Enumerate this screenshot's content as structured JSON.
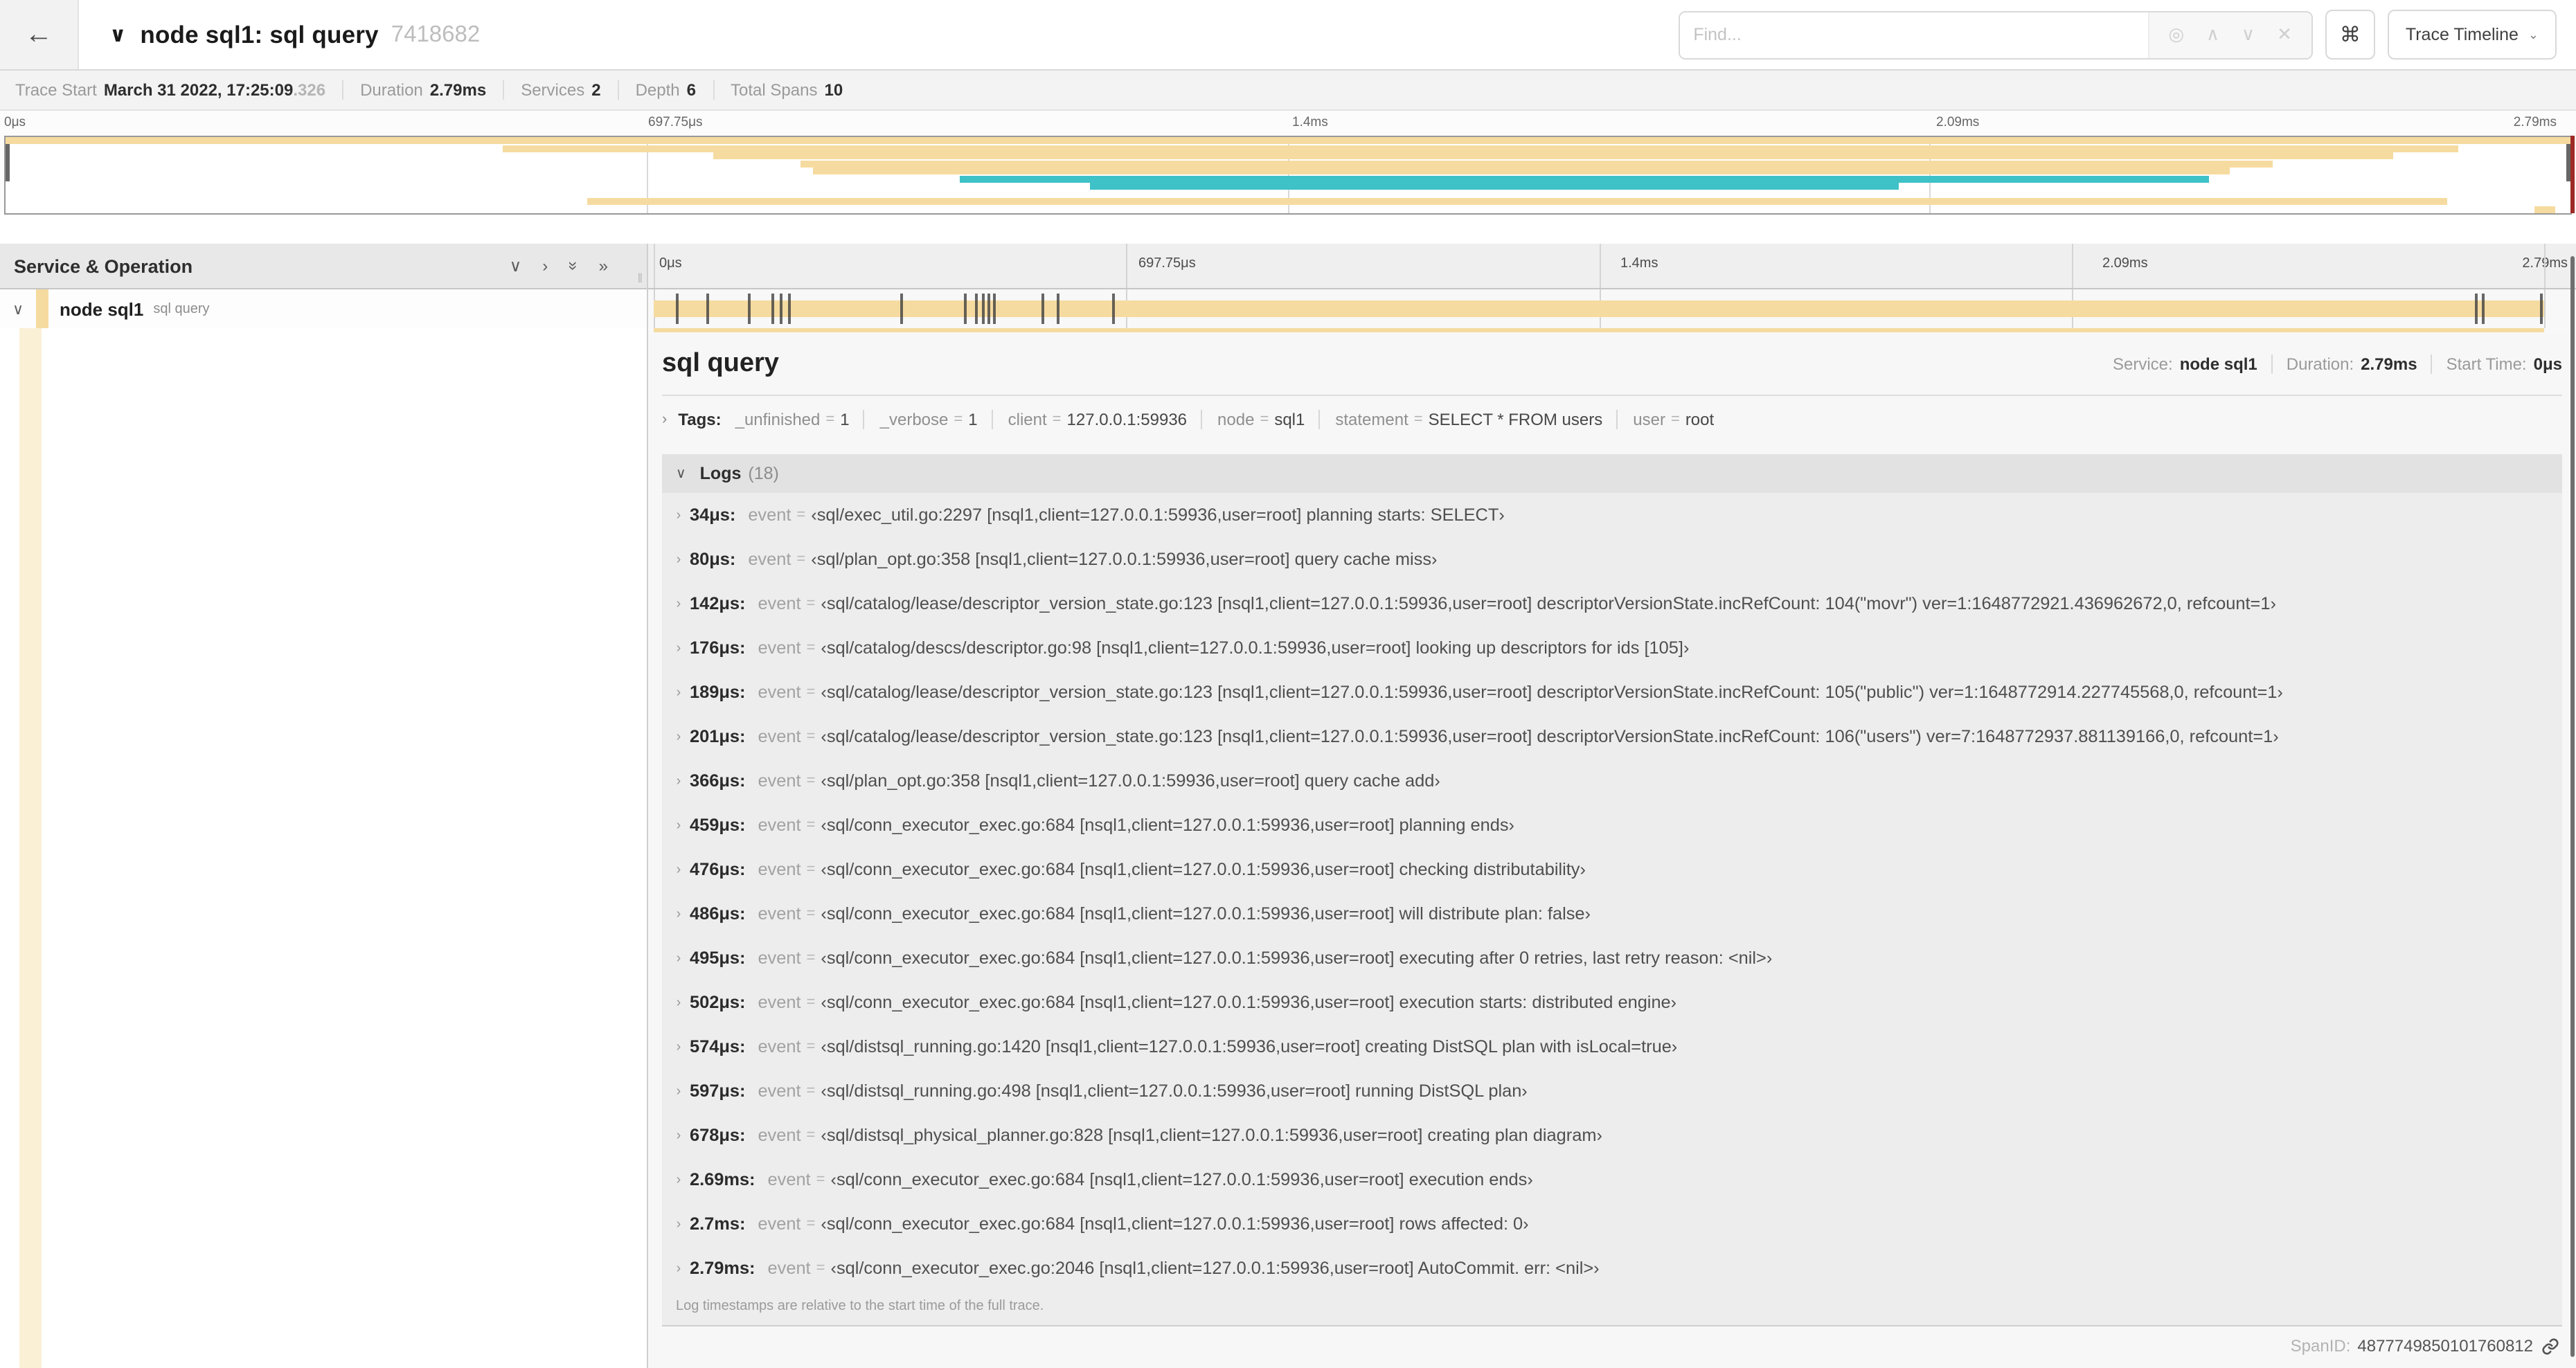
{
  "duration_us": 2790,
  "colors": {
    "tan": "#F6DBA0",
    "teal": "#3FC1C8",
    "cream": "#FAF0D6",
    "accent_red": "#9E2B25"
  },
  "icons": {
    "back": "←",
    "chevron_down": "∨",
    "chevron_right": "›",
    "caret_down": "⌄",
    "collapse_one": "∨",
    "collapse_right": "›",
    "collapse_all": "»",
    "expand_all": "»",
    "locate": "◎",
    "prev": "∧",
    "next": "∨",
    "clear": "✕",
    "keyboard": "⌘",
    "resizer": "❙❙"
  },
  "header": {
    "title": "node sql1: sql query",
    "trace_id": "7418682",
    "find_placeholder": "Find...",
    "view_button": "Trace Timeline"
  },
  "trace_meta": {
    "items": [
      {
        "label": "Trace Start",
        "value": "March 31 2022, 17:25:09",
        "suffix": ".326"
      },
      {
        "label": "Duration",
        "value": "2.79ms",
        "suffix": ""
      },
      {
        "label": "Services",
        "value": "2",
        "suffix": ""
      },
      {
        "label": "Depth",
        "value": "6",
        "suffix": ""
      },
      {
        "label": "Total Spans",
        "value": "10",
        "suffix": ""
      }
    ]
  },
  "timeline_ticks": [
    "0μs",
    "697.75μs",
    "1.4ms",
    "2.09ms",
    "2.79ms"
  ],
  "minimap": {
    "spans": [
      {
        "row": 0,
        "start": 0,
        "end": 100,
        "color": "tan"
      },
      {
        "row": 1,
        "start": 19.4,
        "end": 95.6,
        "color": "tan"
      },
      {
        "row": 2,
        "start": 27.6,
        "end": 93.1,
        "color": "tan"
      },
      {
        "row": 3,
        "start": 31.0,
        "end": 88.4,
        "color": "tan"
      },
      {
        "row": 4,
        "start": 31.5,
        "end": 86.7,
        "color": "tan"
      },
      {
        "row": 5,
        "start": 37.2,
        "end": 85.9,
        "color": "teal"
      },
      {
        "row": 6,
        "start": 42.3,
        "end": 73.8,
        "color": "teal"
      },
      {
        "row": 8,
        "start": 22.7,
        "end": 95.2,
        "color": "tan"
      },
      {
        "row": 9,
        "start": 98.6,
        "end": 99.4,
        "color": "tan"
      }
    ]
  },
  "left_panel": {
    "title": "Service & Operation"
  },
  "span_row": {
    "service": "node sql1",
    "operation": "sql query"
  },
  "detail": {
    "title": "sql query",
    "service_label": "Service:",
    "service": "node sql1",
    "duration_label": "Duration:",
    "duration": "2.79ms",
    "start_label": "Start Time:",
    "start": "0μs"
  },
  "tags": {
    "label": "Tags:",
    "items": [
      {
        "key": "_unfinished",
        "value": "1"
      },
      {
        "key": "_verbose",
        "value": "1"
      },
      {
        "key": "client",
        "value": "127.0.0.1:59936"
      },
      {
        "key": "node",
        "value": "sql1"
      },
      {
        "key": "statement",
        "value": "SELECT * FROM users"
      },
      {
        "key": "user",
        "value": "root"
      }
    ]
  },
  "logs": {
    "label": "Logs",
    "count": "(18)",
    "key": "event",
    "eq": "=",
    "note": "Log timestamps are relative to the start time of the full trace.",
    "items": [
      {
        "time": "34μs:",
        "time_us": 34,
        "value": "‹sql/exec_util.go:2297 [nsql1,client=127.0.0.1:59936,user=root] planning starts: SELECT›"
      },
      {
        "time": "80μs:",
        "time_us": 80,
        "value": "‹sql/plan_opt.go:358 [nsql1,client=127.0.0.1:59936,user=root] query cache miss›"
      },
      {
        "time": "142μs:",
        "time_us": 142,
        "value": "‹sql/catalog/lease/descriptor_version_state.go:123 [nsql1,client=127.0.0.1:59936,user=root] descriptorVersionState.incRefCount: 104(\"movr\") ver=1:1648772921.436962672,0, refcount=1›"
      },
      {
        "time": "176μs:",
        "time_us": 176,
        "value": "‹sql/catalog/descs/descriptor.go:98 [nsql1,client=127.0.0.1:59936,user=root] looking up descriptors for ids [105]›"
      },
      {
        "time": "189μs:",
        "time_us": 189,
        "value": "‹sql/catalog/lease/descriptor_version_state.go:123 [nsql1,client=127.0.0.1:59936,user=root] descriptorVersionState.incRefCount: 105(\"public\") ver=1:1648772914.227745568,0, refcount=1›"
      },
      {
        "time": "201μs:",
        "time_us": 201,
        "value": "‹sql/catalog/lease/descriptor_version_state.go:123 [nsql1,client=127.0.0.1:59936,user=root] descriptorVersionState.incRefCount: 106(\"users\") ver=7:1648772937.881139166,0, refcount=1›"
      },
      {
        "time": "366μs:",
        "time_us": 366,
        "value": "‹sql/plan_opt.go:358 [nsql1,client=127.0.0.1:59936,user=root] query cache add›"
      },
      {
        "time": "459μs:",
        "time_us": 459,
        "value": "‹sql/conn_executor_exec.go:684 [nsql1,client=127.0.0.1:59936,user=root] planning ends›"
      },
      {
        "time": "476μs:",
        "time_us": 476,
        "value": "‹sql/conn_executor_exec.go:684 [nsql1,client=127.0.0.1:59936,user=root] checking distributability›"
      },
      {
        "time": "486μs:",
        "time_us": 486,
        "value": "‹sql/conn_executor_exec.go:684 [nsql1,client=127.0.0.1:59936,user=root] will distribute plan: false›"
      },
      {
        "time": "495μs:",
        "time_us": 495,
        "value": "‹sql/conn_executor_exec.go:684 [nsql1,client=127.0.0.1:59936,user=root] executing after 0 retries, last retry reason: <nil>›"
      },
      {
        "time": "502μs:",
        "time_us": 502,
        "value": "‹sql/conn_executor_exec.go:684 [nsql1,client=127.0.0.1:59936,user=root] execution starts: distributed engine›"
      },
      {
        "time": "574μs:",
        "time_us": 574,
        "value": "‹sql/distsql_running.go:1420 [nsql1,client=127.0.0.1:59936,user=root] creating DistSQL plan with isLocal=true›"
      },
      {
        "time": "597μs:",
        "time_us": 597,
        "value": "‹sql/distsql_running.go:498 [nsql1,client=127.0.0.1:59936,user=root] running DistSQL plan›"
      },
      {
        "time": "678μs:",
        "time_us": 678,
        "value": "‹sql/distsql_physical_planner.go:828 [nsql1,client=127.0.0.1:59936,user=root] creating plan diagram›"
      },
      {
        "time": "2.69ms:",
        "time_us": 2690,
        "value": "‹sql/conn_executor_exec.go:684 [nsql1,client=127.0.0.1:59936,user=root] execution ends›"
      },
      {
        "time": "2.7ms:",
        "time_us": 2700,
        "value": "‹sql/conn_executor_exec.go:684 [nsql1,client=127.0.0.1:59936,user=root] rows affected: 0›"
      },
      {
        "time": "2.79ms:",
        "time_us": 2790,
        "value": "‹sql/conn_executor_exec.go:2046 [nsql1,client=127.0.0.1:59936,user=root] AutoCommit. err: <nil>›"
      }
    ]
  },
  "footer": {
    "spanid_label": "SpanID:",
    "spanid": "4877749850101760812"
  }
}
